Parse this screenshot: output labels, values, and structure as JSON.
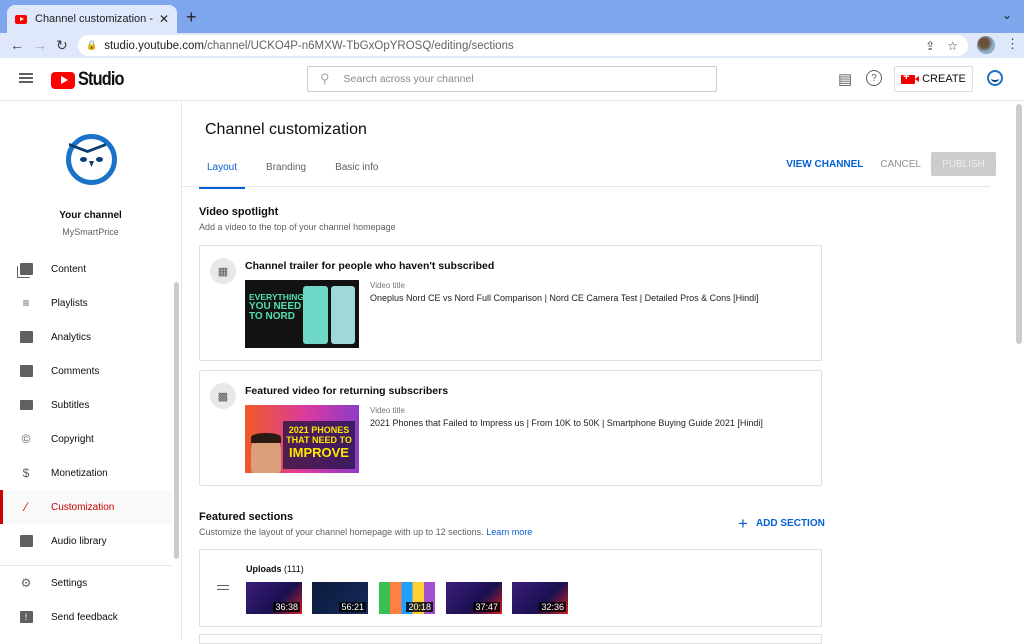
{
  "browser": {
    "tab_title": "Channel customization - YouTube Studio",
    "new_tab_icon": "plus-icon",
    "url_host": "studio.youtube.com",
    "url_path": "/channel/UCKO4P-n6MXW-TbGxOpYROSQ/editing/sections"
  },
  "header": {
    "logo_text": "Studio",
    "search_placeholder": "Search across your channel",
    "create_label": "CREATE"
  },
  "sidebar": {
    "channel_label": "Your channel",
    "channel_name": "MySmartPrice",
    "items": [
      {
        "label": "Content",
        "icon": "content-icon"
      },
      {
        "label": "Playlists",
        "icon": "playlists-icon"
      },
      {
        "label": "Analytics",
        "icon": "analytics-icon"
      },
      {
        "label": "Comments",
        "icon": "comments-icon"
      },
      {
        "label": "Subtitles",
        "icon": "subtitles-icon"
      },
      {
        "label": "Copyright",
        "icon": "copyright-icon"
      },
      {
        "label": "Monetization",
        "icon": "dollar-icon"
      },
      {
        "label": "Customization",
        "icon": "magic-wand-icon",
        "active": true
      },
      {
        "label": "Audio library",
        "icon": "audio-library-icon"
      }
    ],
    "bottom_items": [
      {
        "label": "Settings",
        "icon": "gear-icon"
      },
      {
        "label": "Send feedback",
        "icon": "feedback-icon"
      }
    ]
  },
  "main": {
    "title": "Channel customization",
    "tabs": [
      {
        "label": "Layout",
        "active": true
      },
      {
        "label": "Branding"
      },
      {
        "label": "Basic info"
      }
    ],
    "actions": {
      "view_channel": "VIEW CHANNEL",
      "cancel": "CANCEL",
      "publish": "PUBLISH"
    },
    "video_spotlight": {
      "title": "Video spotlight",
      "subtitle": "Add a video to the top of your channel homepage",
      "trailer": {
        "title": "Channel trailer for people who haven't subscribed",
        "video_label": "Video title",
        "video_title": "Oneplus Nord CE vs Nord Full Comparison | Nord CE Camera Test | Detailed Pros & Cons [Hindi]",
        "thumb_text": [
          "EVERYTHING",
          "YOU NEED",
          "TO NORD"
        ]
      },
      "featured": {
        "title": "Featured video for returning subscribers",
        "video_label": "Video title",
        "video_title": "2021 Phones that Failed to Impress us | From 10K to 50K | Smartphone Buying Guide 2021 [Hindi]",
        "thumb_text": [
          "2021 PHONES",
          "THAT NEED TO",
          "IMPROVE"
        ]
      }
    },
    "featured_sections": {
      "title": "Featured sections",
      "subtitle": "Customize the layout of your channel homepage with up to 12 sections.",
      "learn_more": "Learn more",
      "add_section": "ADD SECTION",
      "uploads": {
        "label": "Uploads",
        "count": "(111)",
        "durations": [
          "36:38",
          "56:21",
          "20:18",
          "37:47",
          "32:36"
        ]
      }
    }
  }
}
